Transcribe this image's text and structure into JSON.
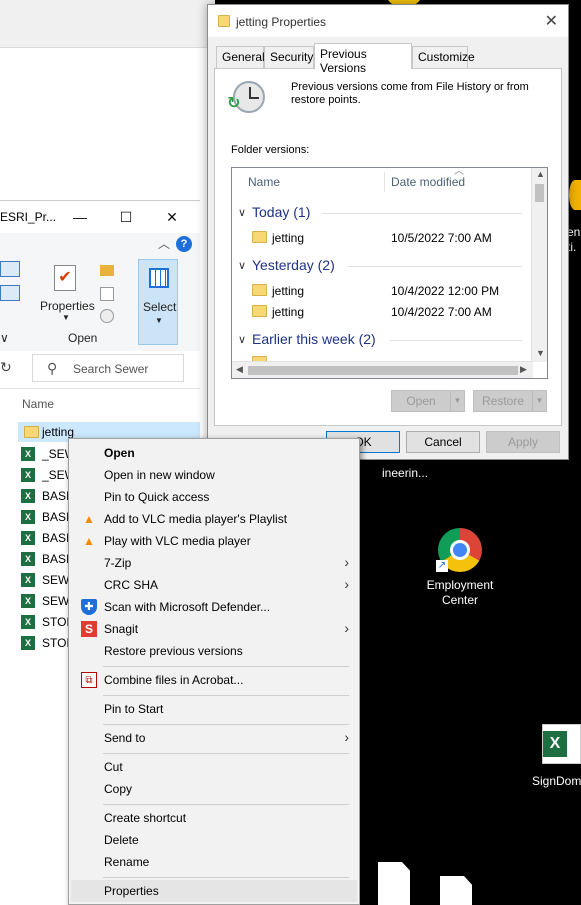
{
  "explorer": {
    "title": "ESRI_Pr...",
    "ribbon": {
      "properties_label": "Properties",
      "open_group_label": "Open",
      "select_label": "Select"
    },
    "search_placeholder": "Search Sewer",
    "column_name": "Name",
    "files": [
      {
        "name": "jetting",
        "type": "folder"
      },
      {
        "name": "_SEW",
        "type": "excel"
      },
      {
        "name": "_SEW",
        "type": "excel"
      },
      {
        "name": "BASI",
        "type": "excel"
      },
      {
        "name": "BASI",
        "type": "excel"
      },
      {
        "name": "BASI",
        "type": "excel"
      },
      {
        "name": "BASI",
        "type": "excel"
      },
      {
        "name": "SEWI",
        "type": "excel"
      },
      {
        "name": "SEWI",
        "type": "excel"
      },
      {
        "name": "STOR",
        "type": "excel"
      },
      {
        "name": "STOR",
        "type": "excel"
      }
    ]
  },
  "properties_dialog": {
    "title": "jetting Properties",
    "tabs": [
      "General",
      "Security",
      "Previous Versions",
      "Customize"
    ],
    "active_tab": "Previous Versions",
    "info_text": "Previous versions come from File History or from restore points.",
    "folder_versions_label": "Folder versions:",
    "columns": {
      "name": "Name",
      "date": "Date modified"
    },
    "groups": [
      {
        "label": "Today (1)",
        "items": [
          {
            "name": "jetting",
            "date": "10/5/2022 7:00 AM"
          }
        ]
      },
      {
        "label": "Yesterday (2)",
        "items": [
          {
            "name": "jetting",
            "date": "10/4/2022 12:00 PM"
          },
          {
            "name": "jetting",
            "date": "10/4/2022 7:00 AM"
          }
        ]
      },
      {
        "label": "Earlier this week (2)",
        "items": []
      }
    ],
    "buttons": {
      "open": "Open",
      "restore": "Restore",
      "ok": "OK",
      "cancel": "Cancel",
      "apply": "Apply"
    }
  },
  "desktop": {
    "icons": [
      {
        "label": "Employment Center",
        "icon": "chrome-icon"
      },
      {
        "label": "SignDom",
        "icon": "excel-icon"
      }
    ],
    "partial_labels": [
      "ineerin...",
      "en",
      "ti."
    ]
  },
  "context_menu": {
    "items": [
      {
        "label": "Open",
        "bold": true
      },
      {
        "label": "Open in new window"
      },
      {
        "label": "Pin to Quick access"
      },
      {
        "label": "Add to VLC media player's Playlist",
        "icon": "vlc-icon"
      },
      {
        "label": "Play with VLC media player",
        "icon": "vlc-icon"
      },
      {
        "label": "7-Zip",
        "submenu": true
      },
      {
        "label": "CRC SHA",
        "submenu": true
      },
      {
        "label": "Scan with Microsoft Defender...",
        "icon": "defender-shield-icon"
      },
      {
        "label": "Snagit",
        "icon": "snagit-icon",
        "submenu": true
      },
      {
        "label": "Restore previous versions"
      },
      {
        "label": "Combine files in Acrobat...",
        "icon": "acrobat-icon"
      },
      {
        "label": "Pin to Start"
      },
      {
        "label": "Send to",
        "submenu": true
      },
      {
        "label": "Cut"
      },
      {
        "label": "Copy"
      },
      {
        "label": "Create shortcut"
      },
      {
        "label": "Delete"
      },
      {
        "label": "Rename"
      },
      {
        "label": "Properties"
      }
    ],
    "submenu_glyph": "›"
  }
}
